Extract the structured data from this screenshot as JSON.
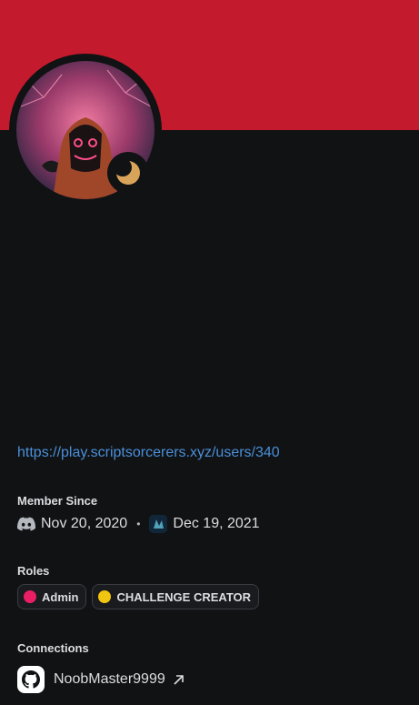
{
  "profile": {
    "banner_color": "#c41a2d",
    "status": "idle",
    "status_icon": "moon-icon",
    "link": "https://play.scriptsorcerers.xyz/users/340"
  },
  "member_since": {
    "title": "Member Since",
    "discord_icon": "discord-icon",
    "discord_date": "Nov 20, 2020",
    "separator": "•",
    "server_date": "Dec 19, 2021"
  },
  "roles": {
    "title": "Roles",
    "items": [
      {
        "name": "Admin",
        "color": "#e91e63"
      },
      {
        "name": "CHALLENGE CREATOR",
        "color": "#f1c40f"
      }
    ]
  },
  "connections": {
    "title": "Connections",
    "items": [
      {
        "service_icon": "github-icon",
        "name": "NoobMaster9999",
        "link_icon": "external-link-icon"
      }
    ]
  }
}
